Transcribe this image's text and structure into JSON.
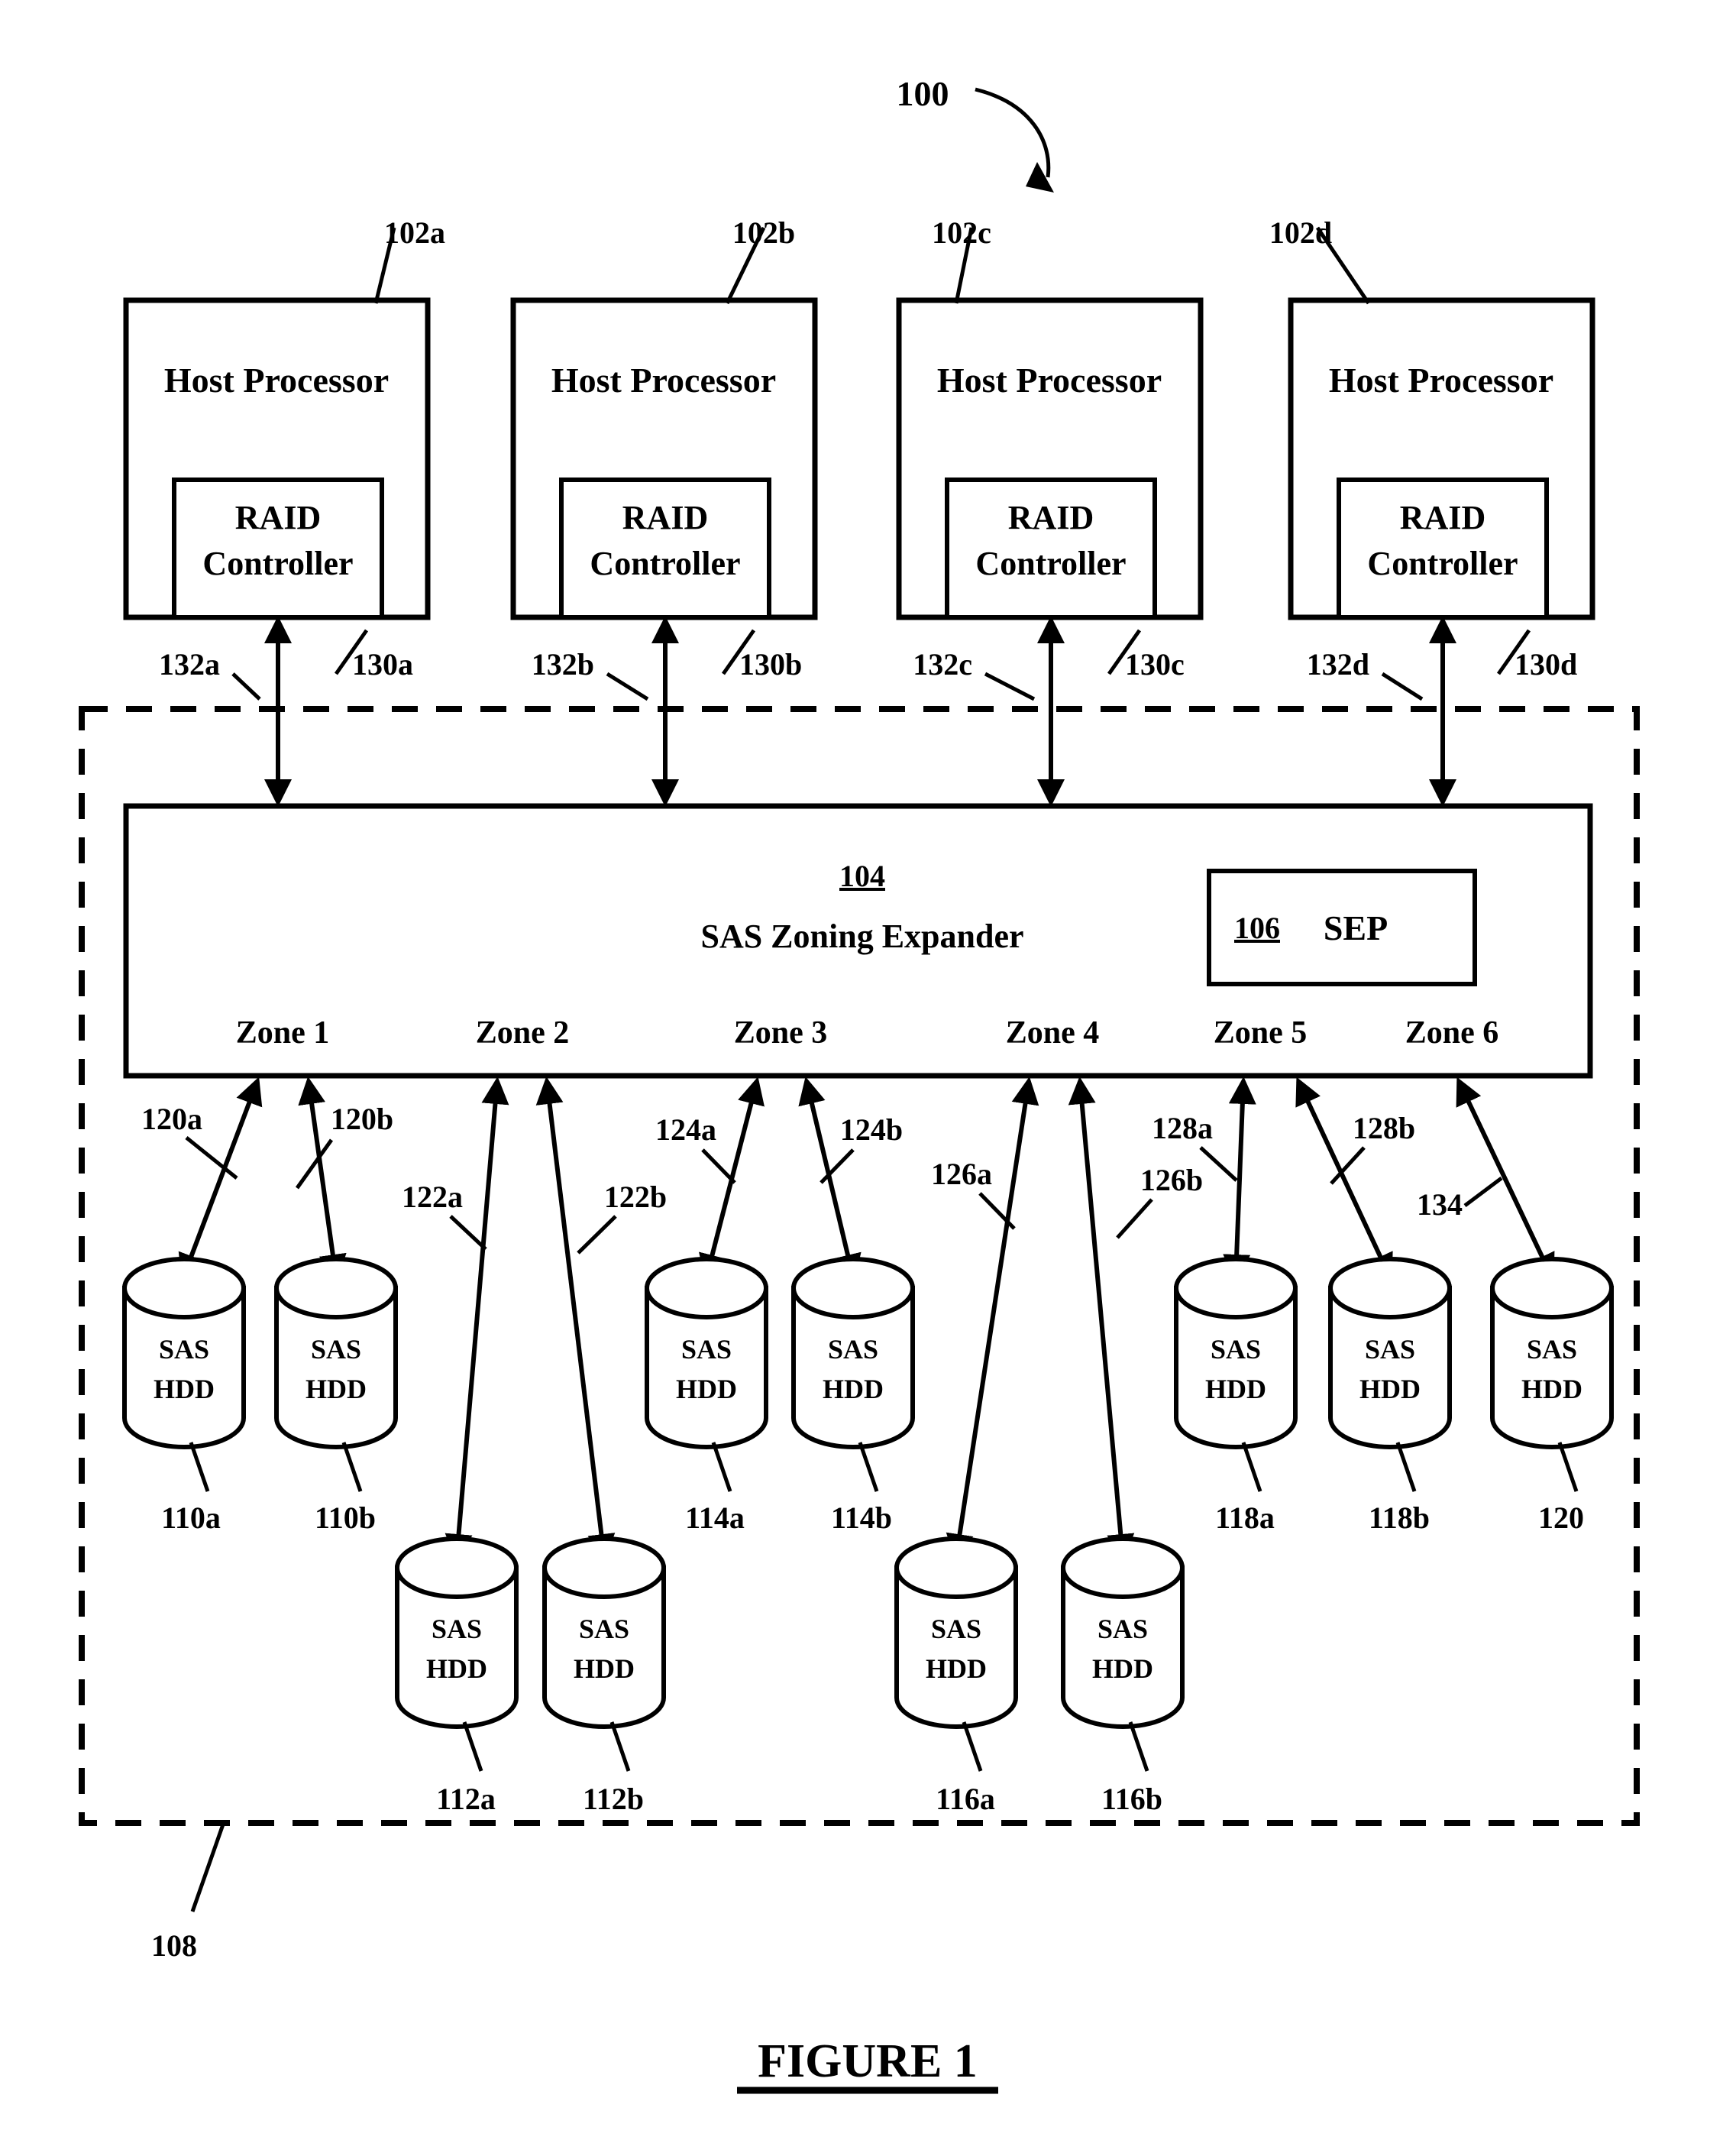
{
  "figure": {
    "caption": "FIGURE 1",
    "system_ref": "100"
  },
  "hosts": [
    {
      "ref": "102a",
      "title": "Host Processor",
      "raid_label_line1": "RAID",
      "raid_label_line2": "Controller",
      "raid_ref": "130a",
      "link_ref": "132a"
    },
    {
      "ref": "102b",
      "title": "Host Processor",
      "raid_label_line1": "RAID",
      "raid_label_line2": "Controller",
      "raid_ref": "130b",
      "link_ref": "132b"
    },
    {
      "ref": "102c",
      "title": "Host Processor",
      "raid_label_line1": "RAID",
      "raid_label_line2": "Controller",
      "raid_ref": "130c",
      "link_ref": "132c"
    },
    {
      "ref": "102d",
      "title": "Host Processor",
      "raid_label_line1": "RAID",
      "raid_label_line2": "Controller",
      "raid_ref": "130d",
      "link_ref": "132d"
    }
  ],
  "expander": {
    "ref": "104",
    "title": "SAS Zoning Expander",
    "sep": {
      "ref": "106",
      "label": "SEP"
    },
    "zones": [
      {
        "label": "Zone 1"
      },
      {
        "label": "Zone 2"
      },
      {
        "label": "Zone 3"
      },
      {
        "label": "Zone 4"
      },
      {
        "label": "Zone 5"
      },
      {
        "label": "Zone 6"
      }
    ]
  },
  "enclosure": {
    "ref": "108"
  },
  "drives": [
    {
      "ref": "110a",
      "line1": "SAS",
      "line2": "HDD",
      "row": "top",
      "zone": "Zone 1"
    },
    {
      "ref": "110b",
      "line1": "SAS",
      "line2": "HDD",
      "row": "top",
      "zone": "Zone 1"
    },
    {
      "ref": "112a",
      "line1": "SAS",
      "line2": "HDD",
      "row": "bottom",
      "zone": "Zone 2"
    },
    {
      "ref": "112b",
      "line1": "SAS",
      "line2": "HDD",
      "row": "bottom",
      "zone": "Zone 2"
    },
    {
      "ref": "114a",
      "line1": "SAS",
      "line2": "HDD",
      "row": "top",
      "zone": "Zone 3"
    },
    {
      "ref": "114b",
      "line1": "SAS",
      "line2": "HDD",
      "row": "top",
      "zone": "Zone 3"
    },
    {
      "ref": "116a",
      "line1": "SAS",
      "line2": "HDD",
      "row": "bottom",
      "zone": "Zone 4"
    },
    {
      "ref": "116b",
      "line1": "SAS",
      "line2": "HDD",
      "row": "bottom",
      "zone": "Zone 4"
    },
    {
      "ref": "118a",
      "line1": "SAS",
      "line2": "HDD",
      "row": "top",
      "zone": "Zone 5"
    },
    {
      "ref": "118b",
      "line1": "SAS",
      "line2": "HDD",
      "row": "top",
      "zone": "Zone 5"
    },
    {
      "ref": "120",
      "line1": "SAS",
      "line2": "HDD",
      "row": "top",
      "zone": "Zone 6"
    }
  ],
  "links": [
    {
      "ref": "120a",
      "from": "Zone 1",
      "to": "110a"
    },
    {
      "ref": "120b",
      "from": "Zone 1",
      "to": "110b"
    },
    {
      "ref": "122a",
      "from": "Zone 2",
      "to": "112a"
    },
    {
      "ref": "122b",
      "from": "Zone 2",
      "to": "112b"
    },
    {
      "ref": "124a",
      "from": "Zone 3",
      "to": "114a"
    },
    {
      "ref": "124b",
      "from": "Zone 3",
      "to": "114b"
    },
    {
      "ref": "126a",
      "from": "Zone 4",
      "to": "116a"
    },
    {
      "ref": "126b",
      "from": "Zone 4",
      "to": "116b"
    },
    {
      "ref": "128a",
      "from": "Zone 5",
      "to": "118a"
    },
    {
      "ref": "128b",
      "from": "Zone 5",
      "to": "118b"
    },
    {
      "ref": "134",
      "from": "Zone 6",
      "to": "120"
    }
  ]
}
